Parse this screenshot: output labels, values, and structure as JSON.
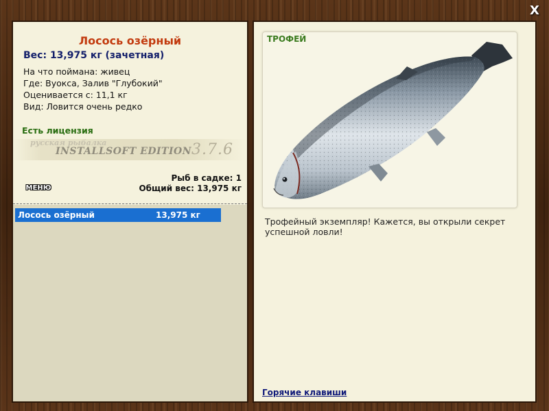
{
  "window": {
    "close_label": "X"
  },
  "fish": {
    "name": "Лосось озёрный",
    "weight_line": "Вес: 13,975 кг (зачетная)",
    "info": [
      "На что поймана: живец",
      "Где: Вуокса, Залив \"Глубокий\"",
      "Оценивается с: 11,1 кг",
      "Вид: Ловится очень редко"
    ],
    "license": "Есть лицензия"
  },
  "banner": {
    "small": "русская рыбалка",
    "main": "INSTALLSOFT EDITION",
    "version": "3.7.6"
  },
  "stats": {
    "count_line": "Рыб в садке: 1",
    "total_line": "Общий вес: 13,975 кг"
  },
  "menu": {
    "label": "МЕНЮ"
  },
  "catch_list": [
    {
      "name": "Лосось озёрный",
      "weight": "13,975 кг",
      "selected": true
    }
  ],
  "photo": {
    "badge": "ТРОФЕЙ"
  },
  "description": "Трофейный экземпляр! Кажется, вы открыли секрет успешной ловли!",
  "hotkeys_link": "Горячие клавиши",
  "colors": {
    "title": "#c23a0e",
    "weight": "#14206b",
    "license": "#2a6e12",
    "selection": "#1a6fd1",
    "link": "#101a7a"
  }
}
